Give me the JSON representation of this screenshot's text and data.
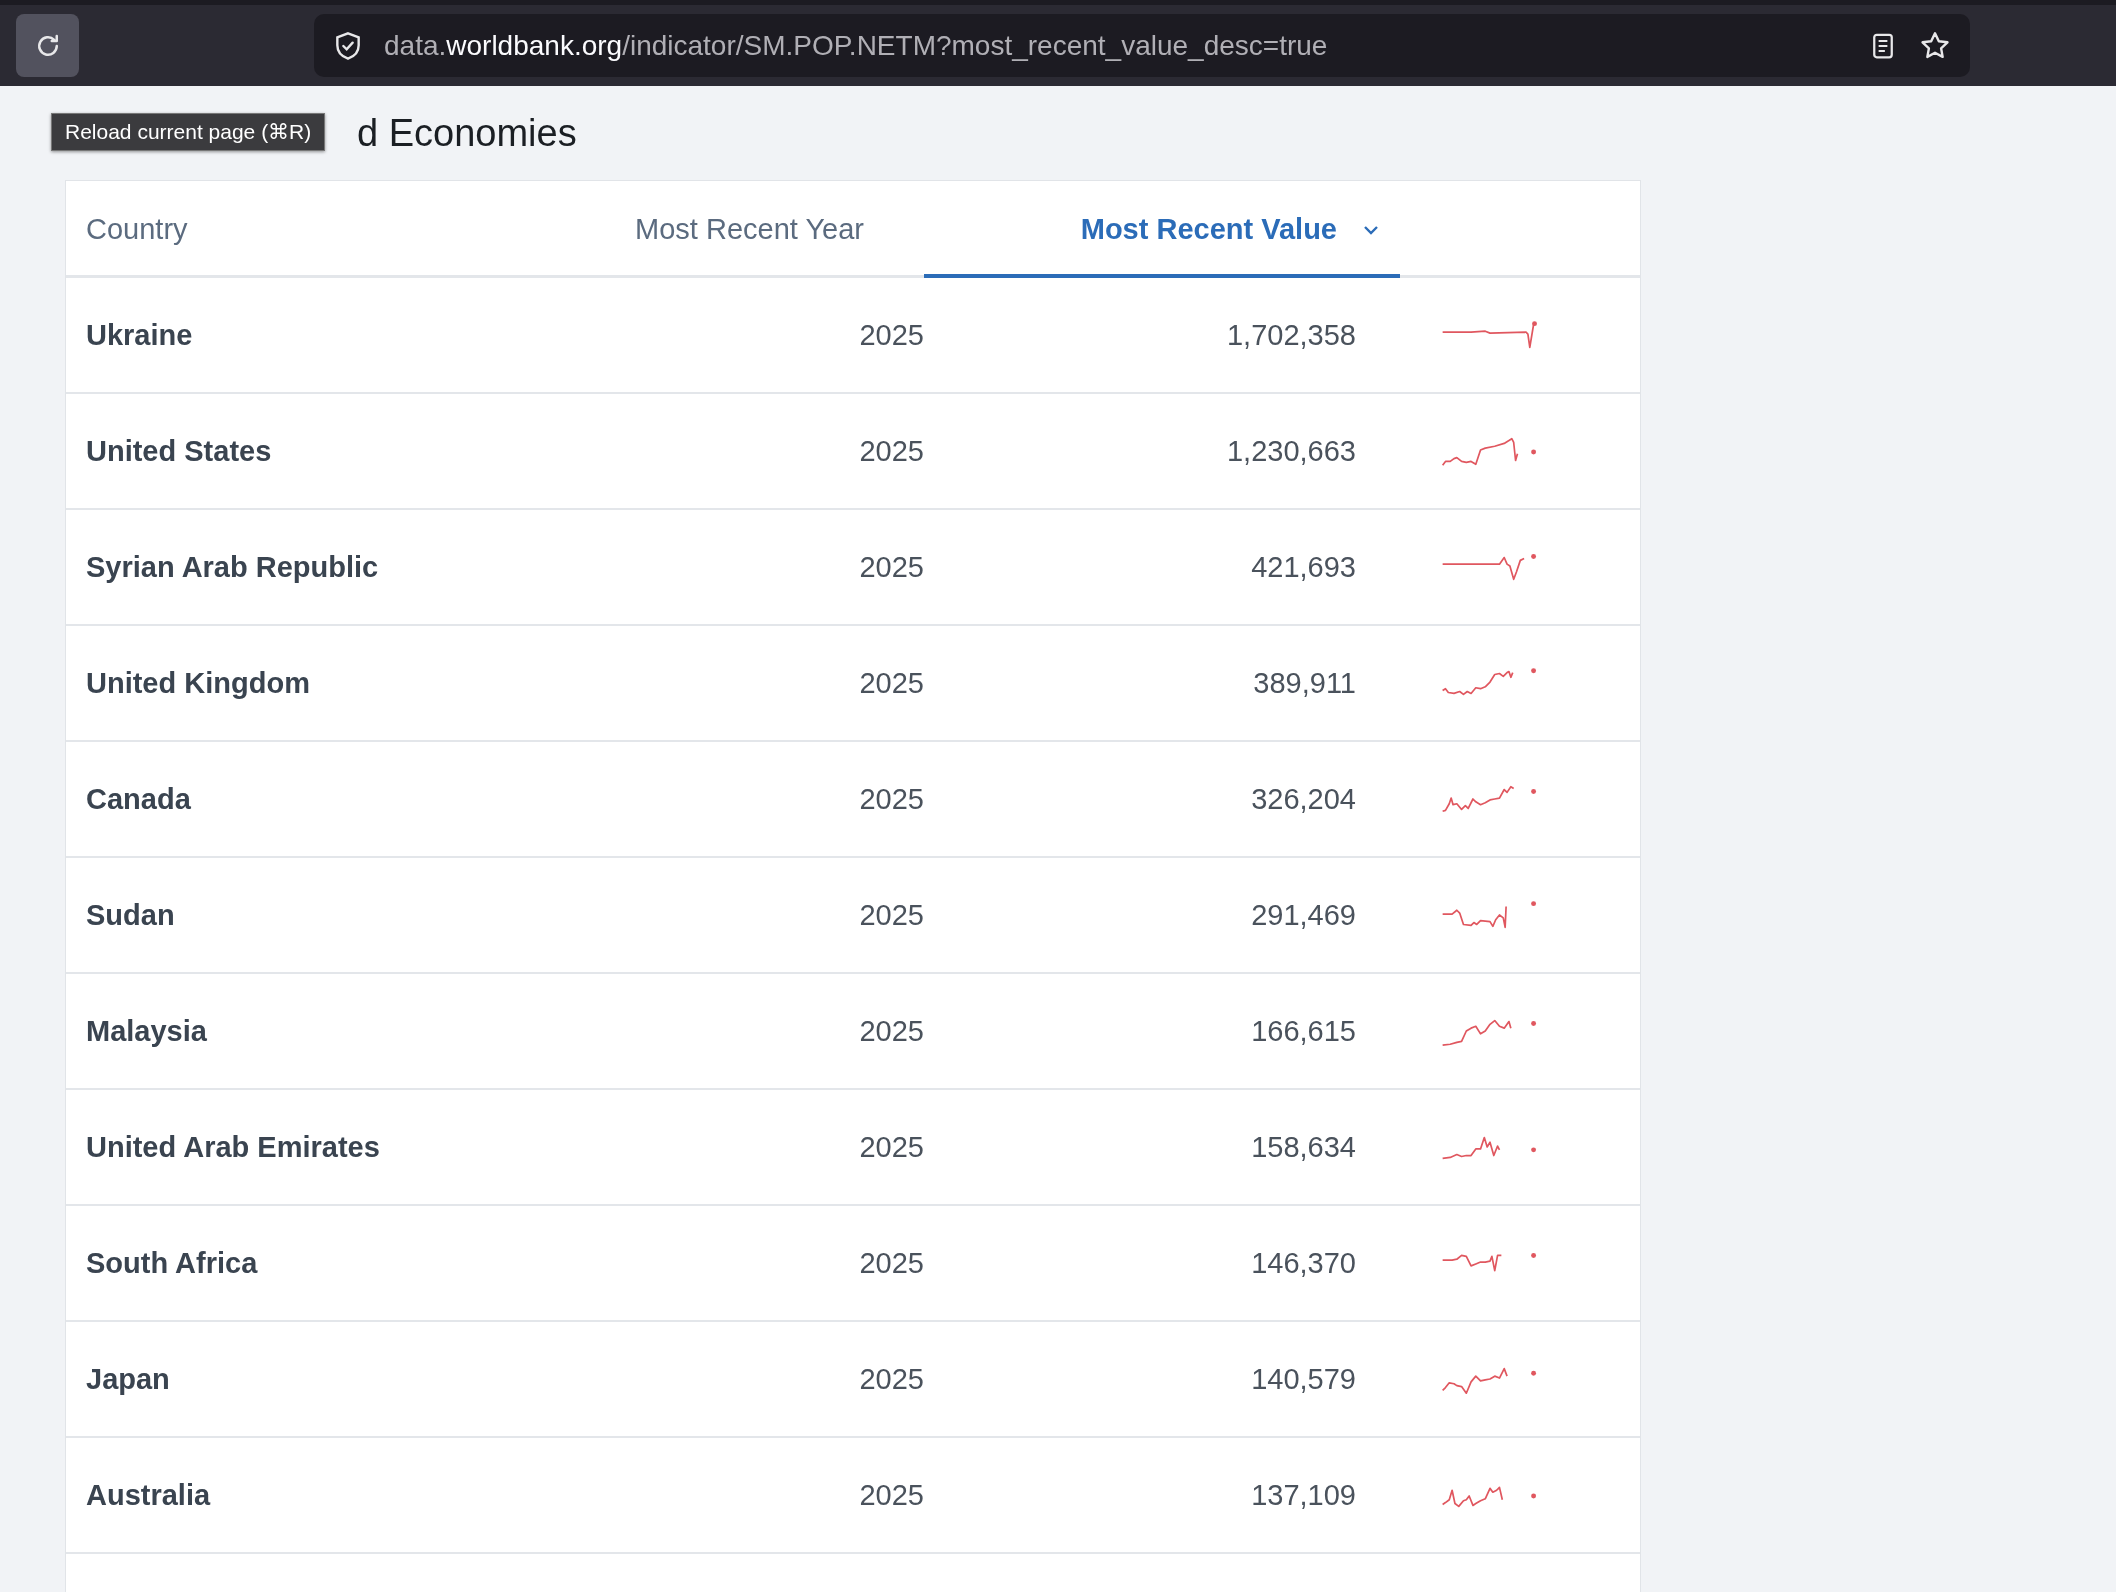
{
  "browser": {
    "url": "data.**worldbank.org**/indicator/SM.POP.NETM?most_recent_value_desc=true",
    "tooltip": "Reload current page (⌘R)"
  },
  "page": {
    "title": "d Economies"
  },
  "table": {
    "columns": [
      {
        "label": "Country",
        "selected": false
      },
      {
        "label": "Most Recent Year",
        "selected": false
      },
      {
        "label": "Most Recent Value",
        "selected": true
      }
    ],
    "rows": [
      {
        "country": "Ukraine",
        "year": "2025",
        "value": "1,702,358"
      },
      {
        "country": "United States",
        "year": "2025",
        "value": "1,230,663"
      },
      {
        "country": "Syrian Arab Republic",
        "year": "2025",
        "value": "421,693"
      },
      {
        "country": "United Kingdom",
        "year": "2025",
        "value": "389,911"
      },
      {
        "country": "Canada",
        "year": "2025",
        "value": "326,204"
      },
      {
        "country": "Sudan",
        "year": "2025",
        "value": "291,469"
      },
      {
        "country": "Malaysia",
        "year": "2025",
        "value": "166,615"
      },
      {
        "country": "United Arab Emirates",
        "year": "2025",
        "value": "158,634"
      },
      {
        "country": "South Africa",
        "year": "2025",
        "value": "146,370"
      },
      {
        "country": "Japan",
        "year": "2025",
        "value": "140,579"
      },
      {
        "country": "Australia",
        "year": "2025",
        "value": "137,109"
      }
    ]
  }
}
